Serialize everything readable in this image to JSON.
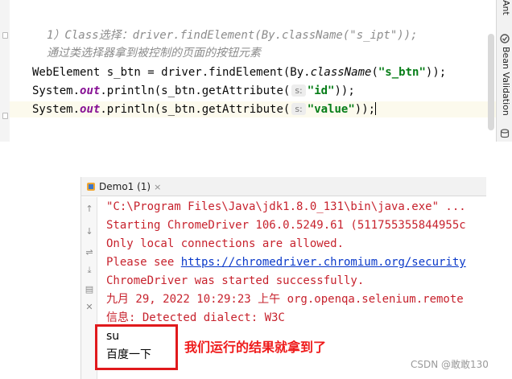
{
  "editor": {
    "comment_line_1": "1）Class选择：driver.findElement(By.className(\"s_ipt\"));",
    "comment_line_2": "通过类选择器拿到被控制的页面的按钮元素",
    "line_3": {
      "part1": "WebElement s_btn = driver.findElement(By.",
      "method": "className",
      "part2": "(",
      "string": "\"s_btn\"",
      "part3": "));"
    },
    "line_4": {
      "part1": "System.",
      "field": "out",
      "part2": ".println(s_btn.getAttribute(",
      "hint": "s:",
      "string": "\"id\"",
      "part3": "));"
    },
    "line_5": {
      "part1": "System.",
      "field": "out",
      "part2": ".println(s_btn.getAttribute(",
      "hint": "s:",
      "string": "\"value\"",
      "part3": "));"
    }
  },
  "right_strip": {
    "tab_top": "Ant",
    "tab_bean": "Bean Validation",
    "icons": [
      "ant-icon",
      "bean-validation-icon",
      "database-icon"
    ]
  },
  "console": {
    "tab_label": "Demo1 (1)",
    "tab_close": "×",
    "toolbar_icons": [
      "up-arrow-icon",
      "down-arrow-icon",
      "wrap-icon",
      "scroll-to-end-icon",
      "print-icon",
      "delete-icon"
    ],
    "lines": {
      "l1": "\"C:\\Program Files\\Java\\jdk1.8.0_131\\bin\\java.exe\" ...",
      "l2": "Starting ChromeDriver 106.0.5249.61 (511755355844955c",
      "l3": "Only local connections are allowed.",
      "l4_prefix": "Please see ",
      "l4_link": "https://chromedriver.chromium.org/security",
      "l5": "ChromeDriver was started successfully.",
      "l6": "九月 29, 2022 10:29:23 上午 org.openqa.selenium.remote",
      "l7": "信息: Detected dialect: W3C",
      "l8": "su",
      "l9": "百度一下"
    }
  },
  "annotation": {
    "text": "我们运行的结果就拿到了",
    "color": "#ef1b1b"
  },
  "watermark": "CSDN @敢敢130"
}
